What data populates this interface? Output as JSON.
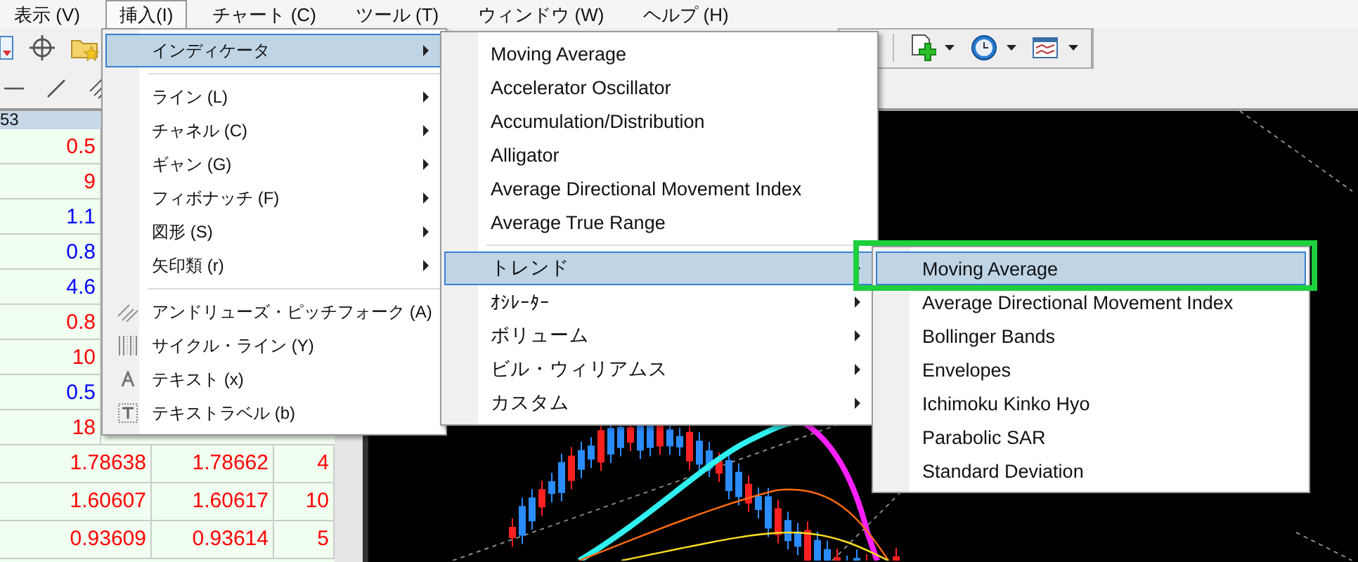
{
  "menubar": [
    {
      "label": "表示 (V)",
      "selected": false
    },
    {
      "label": "挿入(I)",
      "selected": true
    },
    {
      "label": "チャート (C)",
      "selected": false
    },
    {
      "label": "ツール (T)",
      "selected": false
    },
    {
      "label": "ウィンドウ (W)",
      "selected": false
    },
    {
      "label": "ヘルプ (H)",
      "selected": false
    }
  ],
  "market_watch": {
    "header": "53",
    "rows": [
      {
        "cells": [
          "0.5"
        ],
        "color": "#ff0000"
      },
      {
        "cells": [
          "9"
        ],
        "color": "#ff0000"
      },
      {
        "cells": [
          "1.1"
        ],
        "color": "#0000ff"
      },
      {
        "cells": [
          "0.8"
        ],
        "color": "#0000ff"
      },
      {
        "cells": [
          "4.6"
        ],
        "color": "#0000ff"
      },
      {
        "cells": [
          "0.8"
        ],
        "color": "#ff0000"
      },
      {
        "cells": [
          "10"
        ],
        "color": "#ff0000"
      },
      {
        "cells": [
          "0.5"
        ],
        "color": "#0000ff"
      },
      {
        "cells": [
          "18"
        ],
        "color": "#ff0000"
      },
      {
        "cells": [
          "1.78638",
          "1.78662",
          "4"
        ],
        "color": "#ff0000"
      },
      {
        "cells": [
          "1.60607",
          "1.60617",
          "10"
        ],
        "color": "#ff0000"
      },
      {
        "cells": [
          "0.93609",
          "0.93614",
          "5"
        ],
        "color": "#ff0000"
      }
    ]
  },
  "insert_menu": {
    "items": [
      {
        "label": "インディケータ",
        "kind": "submenu",
        "selected": true,
        "separator_before": false
      },
      {
        "label": "ライン (L)",
        "kind": "submenu",
        "selected": false,
        "separator_before": true
      },
      {
        "label": "チャネル (C)",
        "kind": "submenu",
        "selected": false,
        "separator_before": false
      },
      {
        "label": "ギャン (G)",
        "kind": "submenu",
        "selected": false,
        "separator_before": false
      },
      {
        "label": "フィボナッチ (F)",
        "kind": "submenu",
        "selected": false,
        "separator_before": false
      },
      {
        "label": "図形 (S)",
        "kind": "submenu",
        "selected": false,
        "separator_before": false
      },
      {
        "label": "矢印類 (r)",
        "kind": "submenu",
        "selected": false,
        "separator_before": false
      },
      {
        "label": "アンドリューズ・ピッチフォーク (A)",
        "kind": "tool",
        "selected": false,
        "separator_before": true
      },
      {
        "label": "サイクル・ライン (Y)",
        "kind": "tool",
        "selected": false,
        "separator_before": false
      },
      {
        "label": "テキスト (x)",
        "kind": "tool",
        "selected": false,
        "separator_before": false
      },
      {
        "label": "テキストラベル (b)",
        "kind": "tool",
        "selected": false,
        "separator_before": false
      }
    ]
  },
  "indicators_menu": {
    "items": [
      {
        "label": "Moving Average",
        "kind": "command",
        "selected": false,
        "separator_before": false
      },
      {
        "label": "Accelerator Oscillator",
        "kind": "command",
        "selected": false,
        "separator_before": false
      },
      {
        "label": "Accumulation/Distribution",
        "kind": "command",
        "selected": false,
        "separator_before": false
      },
      {
        "label": "Alligator",
        "kind": "command",
        "selected": false,
        "separator_before": false
      },
      {
        "label": "Average Directional Movement Index",
        "kind": "command",
        "selected": false,
        "separator_before": false
      },
      {
        "label": "Average True Range",
        "kind": "command",
        "selected": false,
        "separator_before": false
      },
      {
        "label": "トレンド",
        "kind": "submenu",
        "selected": true,
        "separator_before": true
      },
      {
        "label": "ｵｼﾚｰﾀｰ",
        "kind": "submenu",
        "selected": false,
        "separator_before": false
      },
      {
        "label": "ボリューム",
        "kind": "submenu",
        "selected": false,
        "separator_before": false
      },
      {
        "label": "ビル・ウィリアムス",
        "kind": "submenu",
        "selected": false,
        "separator_before": false
      },
      {
        "label": "カスタム",
        "kind": "submenu",
        "selected": false,
        "separator_before": false
      }
    ]
  },
  "trend_menu": {
    "items": [
      {
        "label": "Moving Average",
        "kind": "command",
        "selected": true,
        "separator_before": false
      },
      {
        "label": "Average Directional Movement Index",
        "kind": "command",
        "selected": false,
        "separator_before": false
      },
      {
        "label": "Bollinger Bands",
        "kind": "command",
        "selected": false,
        "separator_before": false
      },
      {
        "label": "Envelopes",
        "kind": "command",
        "selected": false,
        "separator_before": false
      },
      {
        "label": "Ichimoku Kinko Hyo",
        "kind": "command",
        "selected": false,
        "separator_before": false
      },
      {
        "label": "Parabolic SAR",
        "kind": "command",
        "selected": false,
        "separator_before": false
      },
      {
        "label": "Standard Deviation",
        "kind": "command",
        "selected": false,
        "separator_before": false
      }
    ]
  }
}
